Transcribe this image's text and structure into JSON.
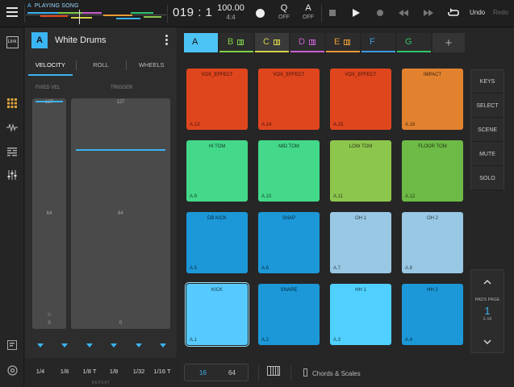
{
  "topbar": {
    "song_slot": "A",
    "song_status": "PLAYING SONG",
    "position": "019 : 1",
    "tempo": "100.00",
    "time_sig": "4:4",
    "quantize_label": "Q",
    "quantize_value": "OFF",
    "auto_label": "A",
    "auto_value": "OFF",
    "undo_label": "Undo",
    "redo_label": "Redo"
  },
  "rail": {
    "link_label": "Link"
  },
  "instrument": {
    "badge": "A",
    "name": "White Drums",
    "tabs": [
      "VELOCITY",
      "ROLL",
      "WHEELS"
    ],
    "fixed_vel_label": "FIXED VEL",
    "trigger_label": "TRIGGER",
    "fixed_vel_top": "127",
    "fixed_vel_mid": "64",
    "fixed_vel_bottom": "0",
    "trigger_top": "127",
    "trigger_mid": "64",
    "trigger_bottom": "0",
    "trigger_level": 0.52,
    "rates": [
      "1/4",
      "1/8",
      "1/8 T",
      "1/8",
      "1/32",
      "1/16 T"
    ],
    "repeat_label": "REPEAT"
  },
  "scenes": [
    {
      "label": "A",
      "color": "#4cc3f5",
      "active": true,
      "mini": false
    },
    {
      "label": "B",
      "color": "#7fcf49",
      "active": false,
      "mini": true
    },
    {
      "label": "C",
      "color": "#d6d24a",
      "active": false,
      "mini": true
    },
    {
      "label": "D",
      "color": "#c85fd0",
      "active": false,
      "mini": true
    },
    {
      "label": "E",
      "color": "#e79a34",
      "active": false,
      "mini": true
    },
    {
      "label": "F",
      "color": "#3b9ae0",
      "active": false,
      "mini": false
    },
    {
      "label": "G",
      "color": "#2fc46a",
      "active": false,
      "mini": false
    }
  ],
  "pads": [
    {
      "name": "VOX_EFFECT",
      "id": "A.13",
      "color": "#e0461e"
    },
    {
      "name": "VOX_EFFECT",
      "id": "A.14",
      "color": "#e0461e"
    },
    {
      "name": "VOX_EFFECT",
      "id": "A.15",
      "color": "#e0461e"
    },
    {
      "name": "IMPACT",
      "id": "A.16",
      "color": "#e2822f"
    },
    {
      "name": "HI TOM",
      "id": "A.9",
      "color": "#44d98a"
    },
    {
      "name": "MID TOM",
      "id": "A.10",
      "color": "#44d98a"
    },
    {
      "name": "LOW TOM",
      "id": "A.11",
      "color": "#8dc64d"
    },
    {
      "name": "FLOOR TOM",
      "id": "A.12",
      "color": "#6dbb46"
    },
    {
      "name": "DB KICK",
      "id": "A.5",
      "color": "#1c98d8"
    },
    {
      "name": "SNAP",
      "id": "A.6",
      "color": "#1c98d8"
    },
    {
      "name": "OH 1",
      "id": "A.7",
      "color": "#98c8e4"
    },
    {
      "name": "OH 2",
      "id": "A.8",
      "color": "#98c8e4"
    },
    {
      "name": "KICK",
      "id": "A.1",
      "color": "#56c9ff",
      "selected": true
    },
    {
      "name": "SNARE",
      "id": "A.2",
      "color": "#1c98d8"
    },
    {
      "name": "HH 1",
      "id": "A.3",
      "color": "#4fd0ff"
    },
    {
      "name": "HH 2",
      "id": "A.4",
      "color": "#1c98d8"
    }
  ],
  "side_buttons": [
    "KEYS",
    "SELECT",
    "SCENE",
    "MUTE",
    "SOLO"
  ],
  "pads_page": {
    "label": "PADS PAGE",
    "value": "1",
    "range": "1-16"
  },
  "bottom": {
    "opt_16": "16",
    "opt_64": "64",
    "chords_label": "Chords & Scales"
  },
  "colors": {
    "accent": "#3ab4f2"
  }
}
